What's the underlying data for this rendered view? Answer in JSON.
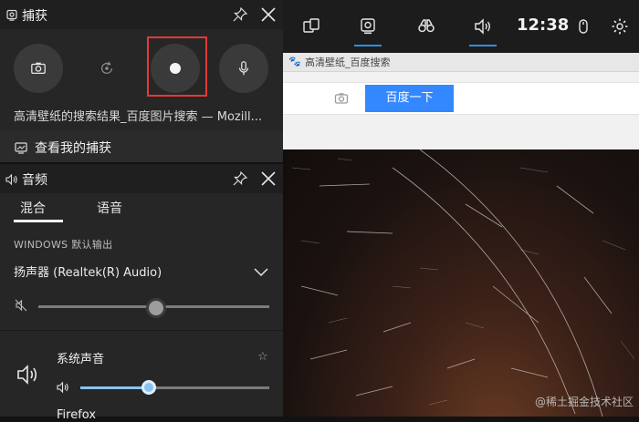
{
  "topbar": {
    "clock": "12:38",
    "icons": [
      "widgets-icon",
      "capture-icon",
      "binoculars-icon",
      "audio-icon",
      "mouse-icon",
      "gear-icon"
    ],
    "accent": "#2f8fe0"
  },
  "capture": {
    "title": "捕获",
    "window_title": "高清壁纸的搜索结果_百度图片搜索 — Mozill...",
    "view_captures": "查看我的捕获",
    "highlight_color": "#e53935"
  },
  "audio": {
    "title": "音频",
    "tabs": [
      {
        "label": "混合",
        "active": true
      },
      {
        "label": "语音",
        "active": false
      }
    ],
    "section_label": "WINDOWS 默认输出",
    "output_device": "扬声器 (Realtek(R) Audio)",
    "master_volume_percent": 51,
    "apps": [
      {
        "name": "系统声音",
        "volume_percent": 36
      },
      {
        "name": "Firefox"
      }
    ]
  },
  "background": {
    "browser_tab_title": "高清壁纸_百度搜索",
    "search_button": "百度一下",
    "watermark": "@稀土掘金技术社区"
  }
}
